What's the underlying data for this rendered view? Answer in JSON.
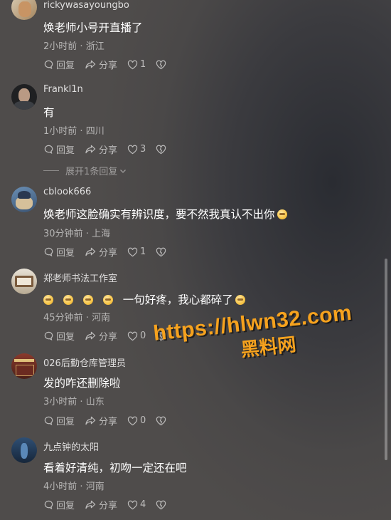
{
  "comments": [
    {
      "username": "rickywasayoungbo",
      "text": "焕老师小号开直播了",
      "time": "2小时前",
      "location": "浙江",
      "reply_label": "回复",
      "share_label": "分享",
      "likes": "1"
    },
    {
      "username": "Frankl1n",
      "text": "有",
      "time": "1小时前",
      "location": "四川",
      "reply_label": "回复",
      "share_label": "分享",
      "likes": "3",
      "expand_label": "展开1条回复"
    },
    {
      "username": "cblook666",
      "text": "焕老师这脸确实有辨识度，要不然我真认不出你",
      "time": "30分钟前",
      "location": "上海",
      "reply_label": "回复",
      "share_label": "分享",
      "likes": "1"
    },
    {
      "username": "郑老师书法工作室",
      "text": "一句好疼，我心都碎了",
      "time": "45分钟前",
      "location": "河南",
      "reply_label": "回复",
      "share_label": "分享",
      "likes": "0"
    },
    {
      "username": "026后勤仓库管理员",
      "text": "发的咋还删除啦",
      "time": "3小时前",
      "location": "山东",
      "reply_label": "回复",
      "share_label": "分享",
      "likes": "0"
    },
    {
      "username": "九点钟的太阳",
      "text": "看着好清纯，初吻一定还在吧",
      "time": "4小时前",
      "location": "河南",
      "reply_label": "回复",
      "share_label": "分享",
      "likes": "4"
    }
  ],
  "meta_separator": "·",
  "watermark": {
    "url": "https://hlwn32.com",
    "title": "黑料网"
  },
  "colors": {
    "accent": "#f6a21e",
    "background": "#3b3b3f"
  }
}
